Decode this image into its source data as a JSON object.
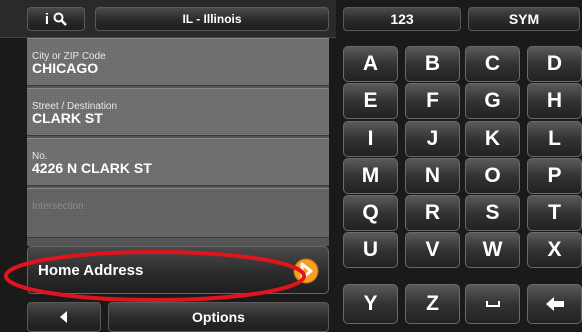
{
  "header": {
    "info_icon_text": "i",
    "state_label": "IL - Illinois",
    "tab_123": "123",
    "tab_sym": "SYM"
  },
  "fields": {
    "city": {
      "label": "City or ZIP Code",
      "value": "CHICAGO"
    },
    "street": {
      "label": "Street / Destination",
      "value": "CLARK ST"
    },
    "number": {
      "label": "No.",
      "value": "4226 N CLARK ST"
    },
    "intersection": {
      "label": "Intersection",
      "value": ""
    }
  },
  "home_address_label": "Home Address",
  "footer": {
    "options_label": "Options"
  },
  "keyboard": {
    "rows": [
      [
        "A",
        "B",
        "C",
        "D"
      ],
      [
        "E",
        "F",
        "G",
        "H"
      ],
      [
        "I",
        "J",
        "K",
        "L"
      ],
      [
        "M",
        "N",
        "O",
        "P"
      ],
      [
        "Q",
        "R",
        "S",
        "T"
      ],
      [
        "U",
        "V",
        "W",
        "X"
      ],
      [
        "Y",
        "Z",
        "space",
        "backspace"
      ]
    ]
  },
  "colors": {
    "annotation_circle": "#e0141c",
    "go_arrow": "#f5a020"
  }
}
